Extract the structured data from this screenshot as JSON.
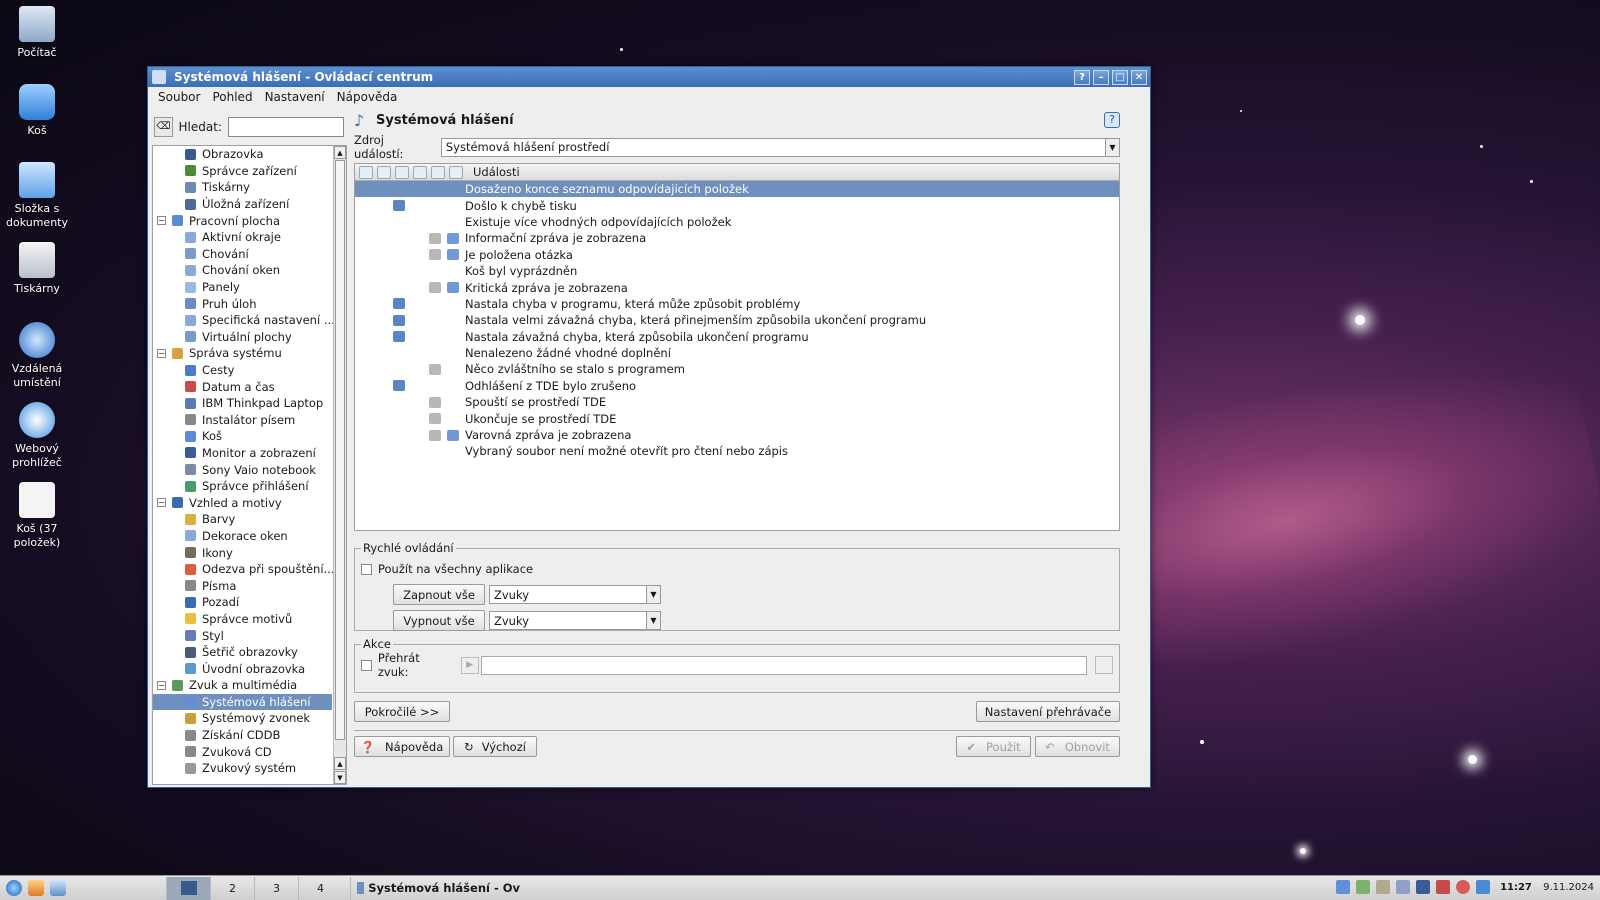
{
  "desktop": {
    "icons": [
      "Počítač",
      "Koš",
      "Složka s dokumenty",
      "Tiskárny",
      "Vzdálená umístění",
      "Webový prohlížeč",
      "Koš (37 položek)"
    ]
  },
  "window": {
    "title": "Systémová hlášení - Ovládací centrum",
    "controls": [
      "?",
      "–",
      "□",
      "✕"
    ]
  },
  "menu": [
    "Soubor",
    "Pohled",
    "Nastavení",
    "Nápověda"
  ],
  "search": {
    "label": "Hledat:",
    "value": ""
  },
  "tree": [
    {
      "type": "child",
      "label": "Obrazovka",
      "color": "#3a5a8a"
    },
    {
      "type": "child",
      "label": "Správce zařízení",
      "color": "#4a8a3a"
    },
    {
      "type": "child",
      "label": "Tiskárny",
      "color": "#6a8ab8"
    },
    {
      "type": "child",
      "label": "Úložná zařízení",
      "color": "#4a6a9a"
    },
    {
      "type": "group",
      "label": "Pracovní plocha",
      "color": "#5a8ad0"
    },
    {
      "type": "child",
      "label": "Aktivní okraje",
      "color": "#8aa8d8"
    },
    {
      "type": "child",
      "label": "Chování",
      "color": "#7a9ac8"
    },
    {
      "type": "child",
      "label": "Chování oken",
      "color": "#8aa8d8"
    },
    {
      "type": "child",
      "label": "Panely",
      "color": "#9ab8e8"
    },
    {
      "type": "child",
      "label": "Pruh úloh",
      "color": "#6a8ac8"
    },
    {
      "type": "child",
      "label": "Specifická nastavení ...",
      "color": "#8aa8d8"
    },
    {
      "type": "child",
      "label": "Virtuální plochy",
      "color": "#7a9ac8"
    },
    {
      "type": "group",
      "label": "Správa systému",
      "color": "#d8a040"
    },
    {
      "type": "child",
      "label": "Cesty",
      "color": "#4a7ac8"
    },
    {
      "type": "child",
      "label": "Datum a čas",
      "color": "#c84a4a"
    },
    {
      "type": "child",
      "label": "IBM Thinkpad Laptop",
      "color": "#5a7ab8"
    },
    {
      "type": "child",
      "label": "Instalátor písem",
      "color": "#888888"
    },
    {
      "type": "child",
      "label": "Koš",
      "color": "#5a8ad8"
    },
    {
      "type": "child",
      "label": "Monitor a zobrazení",
      "color": "#3a5a9a"
    },
    {
      "type": "child",
      "label": "Sony Vaio notebook",
      "color": "#7a8aa8"
    },
    {
      "type": "child",
      "label": "Správce přihlášení",
      "color": "#4a9a6a"
    },
    {
      "type": "group",
      "label": "Vzhled a motivy",
      "color": "#3a6ab0"
    },
    {
      "type": "child",
      "label": "Barvy",
      "color": "#d8b040"
    },
    {
      "type": "child",
      "label": "Dekorace oken",
      "color": "#8aa8d8"
    },
    {
      "type": "child",
      "label": "Ikony",
      "color": "#7a6a5a"
    },
    {
      "type": "child",
      "label": "Odezva při spouštění...",
      "color": "#d86040"
    },
    {
      "type": "child",
      "label": "Písma",
      "color": "#888888"
    },
    {
      "type": "child",
      "label": "Pozadí",
      "color": "#3a6ab0"
    },
    {
      "type": "child",
      "label": "Správce motivů",
      "color": "#e8c040"
    },
    {
      "type": "child",
      "label": "Styl",
      "color": "#6a7ab8"
    },
    {
      "type": "child",
      "label": "Šetřič obrazovky",
      "color": "#4a5a7a"
    },
    {
      "type": "child",
      "label": "Úvodní obrazovka",
      "color": "#5a9ad0"
    },
    {
      "type": "group",
      "label": "Zvuk a multimédia",
      "color": "#5a9a5a"
    },
    {
      "type": "child",
      "label": "Systémová hlášení",
      "color": "#6a8ad8",
      "selected": true
    },
    {
      "type": "child",
      "label": "Systémový zvonek",
      "color": "#c8a040"
    },
    {
      "type": "child",
      "label": "Získání CDDB",
      "color": "#888888"
    },
    {
      "type": "child",
      "label": "Zvuková CD",
      "color": "#888888"
    },
    {
      "type": "child",
      "label": "Zvukový systém",
      "color": "#999999"
    }
  ],
  "page": {
    "title": "Systémová hlášení",
    "source_label": "Zdroj událostí:",
    "source_value": "Systémová hlášení prostředí",
    "events_header": "Události"
  },
  "events": [
    {
      "label": "Dosaženo konce seznamu odpovídajících položek",
      "c2": false,
      "c4": false,
      "c5": false,
      "selected": true
    },
    {
      "label": "Došlo k chybě tisku",
      "c2": true,
      "c4": false,
      "c5": false
    },
    {
      "label": "Existuje více vhodných odpovídajících položek",
      "c2": false,
      "c4": false,
      "c5": false
    },
    {
      "label": "Informační zpráva je zobrazena",
      "c2": false,
      "c4": true,
      "c5": true
    },
    {
      "label": "Je položena otázka",
      "c2": false,
      "c4": true,
      "c5": true
    },
    {
      "label": "Koš byl vyprázdněn",
      "c2": false,
      "c4": false,
      "c5": false
    },
    {
      "label": "Kritická zpráva je zobrazena",
      "c2": false,
      "c4": true,
      "c5": true
    },
    {
      "label": "Nastala chyba v programu, která může způsobit problémy",
      "c2": true,
      "c4": false,
      "c5": false
    },
    {
      "label": "Nastala velmi závažná chyba, která přinejmenším způsobila ukončení programu",
      "c2": true,
      "c4": false,
      "c5": false
    },
    {
      "label": "Nastala závažná chyba, která způsobila ukončení programu",
      "c2": true,
      "c4": false,
      "c5": false
    },
    {
      "label": "Nenalezeno žádné vhodné doplnění",
      "c2": false,
      "c4": false,
      "c5": false
    },
    {
      "label": "Něco zvláštního se stalo s programem",
      "c2": false,
      "c4": true,
      "c5": false
    },
    {
      "label": "Odhlášení z TDE bylo zrušeno",
      "c2": true,
      "c4": false,
      "c5": false
    },
    {
      "label": "Spouští se prostředí TDE",
      "c2": false,
      "c4": true,
      "c5": false
    },
    {
      "label": "Ukončuje se prostředí TDE",
      "c2": false,
      "c4": true,
      "c5": false
    },
    {
      "label": "Varovná zpráva je zobrazena",
      "c2": false,
      "c4": true,
      "c5": true
    },
    {
      "label": "Vybraný soubor není možné otevřít pro čtení nebo zápis",
      "c2": false,
      "c4": false,
      "c5": false
    }
  ],
  "quick": {
    "legend": "Rychlé ovládání",
    "apply_all": "Použít na všechny aplikace",
    "enable_all": "Zapnout vše",
    "disable_all": "Vypnout vše",
    "enable_combo": "Zvuky",
    "disable_combo": "Zvuky"
  },
  "action": {
    "legend": "Akce",
    "play_sound": "Přehrát zvuk:",
    "sound_path": ""
  },
  "buttons": {
    "advanced": "Pokročilé >>",
    "player_settings": "Nastavení přehrávače",
    "help": "Nápověda",
    "defaults": "Výchozí",
    "apply": "Použít",
    "reset": "Obnovit"
  },
  "taskbar": {
    "desktops": [
      "2",
      "3",
      "4"
    ],
    "task": "Systémová hlášení - Ov",
    "time": "11:27",
    "date": "9.11.2024"
  }
}
